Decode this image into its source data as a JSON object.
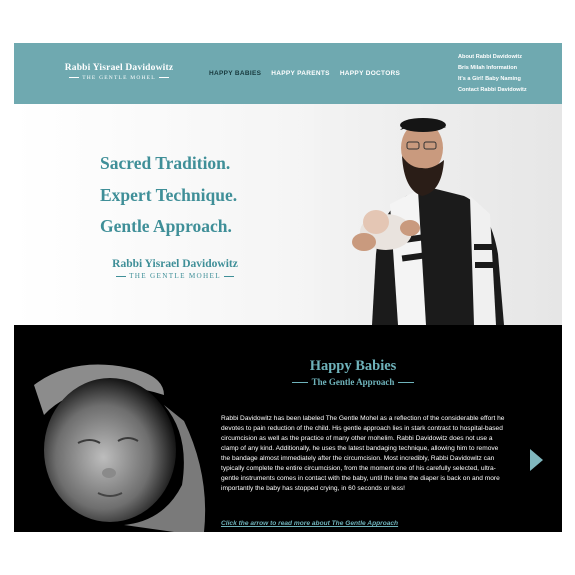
{
  "header": {
    "brand_name": "Rabbi Yisrael Davidowitz",
    "brand_subtitle": "THE GENTLE MOHEL",
    "main_nav": [
      "HAPPY BABIES",
      "HAPPY PARENTS",
      "HAPPY DOCTORS"
    ],
    "active_nav": "HAPPY BABIES",
    "sub_nav": [
      "About Rabbi Davidowitz",
      "Bris Milah Information",
      "It's a Girl! Baby Naming",
      "Contact Rabbi Davidowitz"
    ]
  },
  "hero": {
    "tagline_1": "Sacred Tradition.",
    "tagline_2": "Expert Technique.",
    "tagline_3": "Gentle Approach.",
    "name": "Rabbi Yisrael Davidowitz",
    "subtitle": "THE GENTLE MOHEL"
  },
  "section": {
    "title": "Happy Babies",
    "subtitle": "The Gentle Approach",
    "body": "Rabbi Davidowitz has been labeled The Gentle Mohel as a reflection of the considerable effort he devotes to pain reduction of the child. His gentle approach lies in stark contrast to hospital-based circumcision as well as the practice of many other mohelim. Rabbi Davidowitz does not use a clamp of any kind. Additionally, he uses the latest bandaging technique, allowing him to remove the bandage almost immediately after the circumcision.  Most incredibly, Rabbi Davidowitz can typically complete the entire circumcision, from the moment one of his carefully selected, ultra-gentle instruments comes in contact with the baby, until the time the diaper is back on and more importantly the baby has stopped crying, in 60 seconds or less!",
    "read_more": "Click the arrow to read more about The Gentle Approach"
  },
  "colors": {
    "header_bg": "#6fa9b0",
    "accent_teal": "#3f8f98",
    "dark_bg": "#000000",
    "active_nav": "#18393d"
  },
  "icons": {
    "next": "triangle-right-arrow-icon"
  }
}
